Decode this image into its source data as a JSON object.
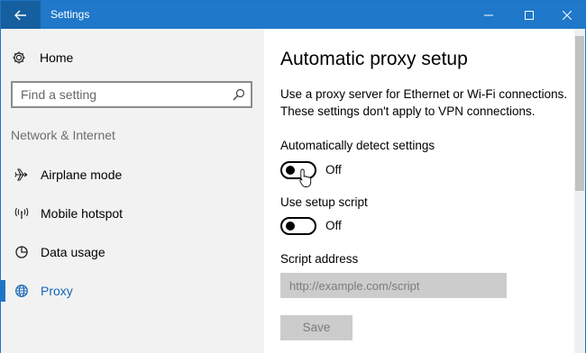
{
  "window": {
    "title": "Settings"
  },
  "sidebar": {
    "home_label": "Home",
    "search_placeholder": "Find a setting",
    "section_label": "Network & Internet",
    "items": [
      {
        "label": "Airplane mode",
        "icon": "airplane-icon",
        "selected": false
      },
      {
        "label": "Mobile hotspot",
        "icon": "hotspot-icon",
        "selected": false
      },
      {
        "label": "Data usage",
        "icon": "data-usage-icon",
        "selected": false
      },
      {
        "label": "Proxy",
        "icon": "globe-icon",
        "selected": true
      }
    ]
  },
  "main": {
    "title": "Automatic proxy setup",
    "description_line1": "Use a proxy server for Ethernet or Wi-Fi connections.",
    "description_line2": "These settings don't apply to VPN connections.",
    "auto_detect": {
      "label": "Automatically detect settings",
      "state": "Off"
    },
    "setup_script": {
      "label": "Use setup script",
      "state": "Off"
    },
    "script_address": {
      "label": "Script address",
      "placeholder": "http://example.com/script"
    },
    "save_label": "Save"
  },
  "colors": {
    "titlebar": "#1f78c9",
    "back_button": "#165f9f",
    "accent": "#1266b5",
    "sidebar_bg": "#f2f2f2",
    "disabled_bg": "#cccccc"
  }
}
